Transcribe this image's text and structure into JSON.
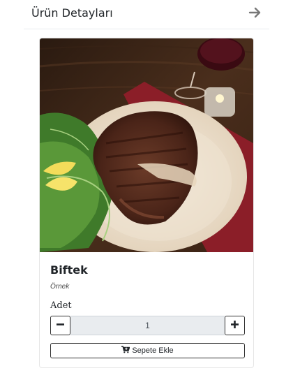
{
  "header": {
    "title": "Ürün Detayları",
    "back_icon": "arrow-right-icon"
  },
  "product": {
    "name": "Biftek",
    "subtitle": "Örnek",
    "image_icon": "steak-photo"
  },
  "quantity": {
    "label": "Adet",
    "value": "1",
    "minus_icon": "minus-icon",
    "plus_icon": "plus-icon"
  },
  "cart": {
    "button_label": "Sepete Ekle",
    "icon": "cart-plus-icon"
  },
  "colors": {
    "accent_border": "#333333",
    "input_bg": "#e9ecef"
  }
}
